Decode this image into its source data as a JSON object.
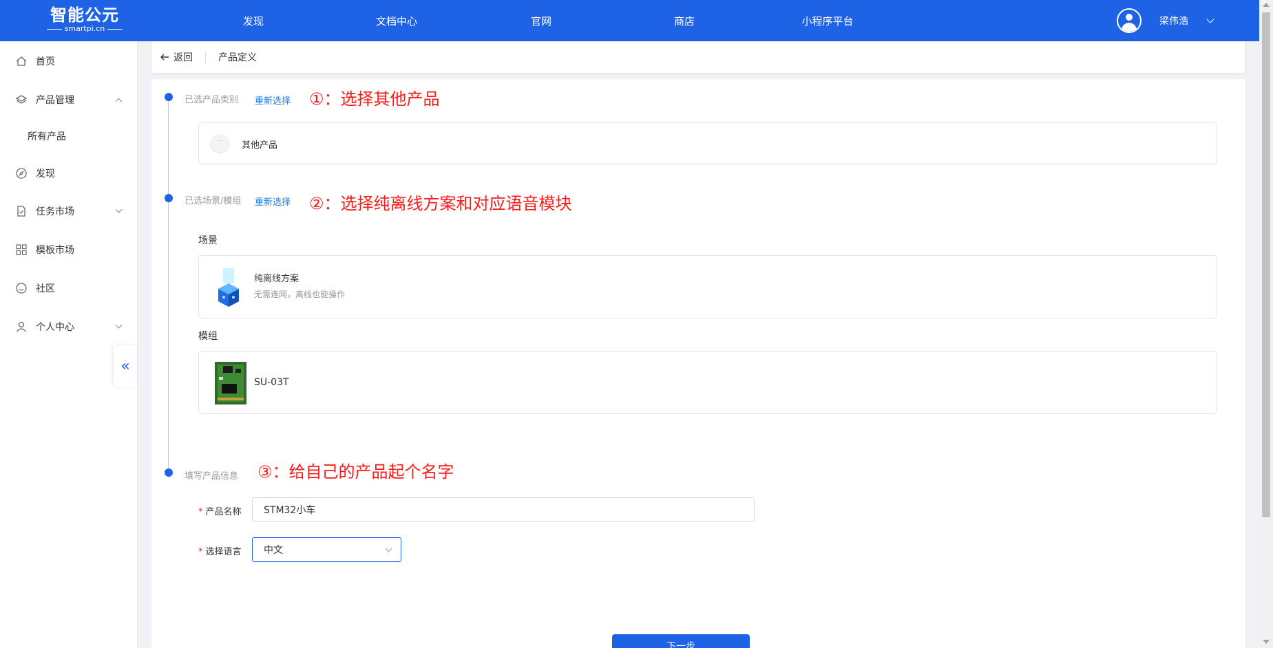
{
  "header": {
    "logo_brand": "智能公元",
    "logo_sub": "smartpi.cn",
    "nav": [
      "发现",
      "文档中心",
      "官网",
      "商店",
      "小程序平台"
    ],
    "user_name": "梁伟浩"
  },
  "sidebar": {
    "items": [
      {
        "label": "首页",
        "icon": "home-icon"
      },
      {
        "label": "产品管理",
        "icon": "layers-icon"
      },
      {
        "label": "所有产品"
      },
      {
        "label": "发现",
        "icon": "compass-icon"
      },
      {
        "label": "任务市场",
        "icon": "task-icon"
      },
      {
        "label": "模板市场",
        "icon": "grid-icon"
      },
      {
        "label": "社区",
        "icon": "smile-icon"
      },
      {
        "label": "个人中心",
        "icon": "user-icon"
      }
    ],
    "collapse_glyph": "«"
  },
  "breadcrumb": {
    "back_label": "返回",
    "current": "产品定义"
  },
  "steps": {
    "step1": {
      "label": "已选产品类别",
      "reselect": "重新选择",
      "annotation": "①：选择其他产品",
      "product_name": "其他产品"
    },
    "step2": {
      "label": "已选场景/模组",
      "reselect": "重新选择",
      "annotation": "②：选择纯离线方案和对应语音模块",
      "scene_title": "场景",
      "scene_name": "纯离线方案",
      "scene_desc": "无需连网，离线也能操作",
      "module_title": "模组",
      "module_name": "SU-03T"
    },
    "step3": {
      "label": "填写产品信息",
      "annotation": "③：给自己的产品起个名字",
      "name_label": "产品名称",
      "name_value": "STM32小车",
      "lang_label": "选择语言",
      "lang_value": "中文",
      "required_mark": "*"
    }
  },
  "next_button": "下一步",
  "colors": {
    "primary": "#1e62e6",
    "annotation": "#ff1a1a",
    "link": "#1e7ce6"
  }
}
